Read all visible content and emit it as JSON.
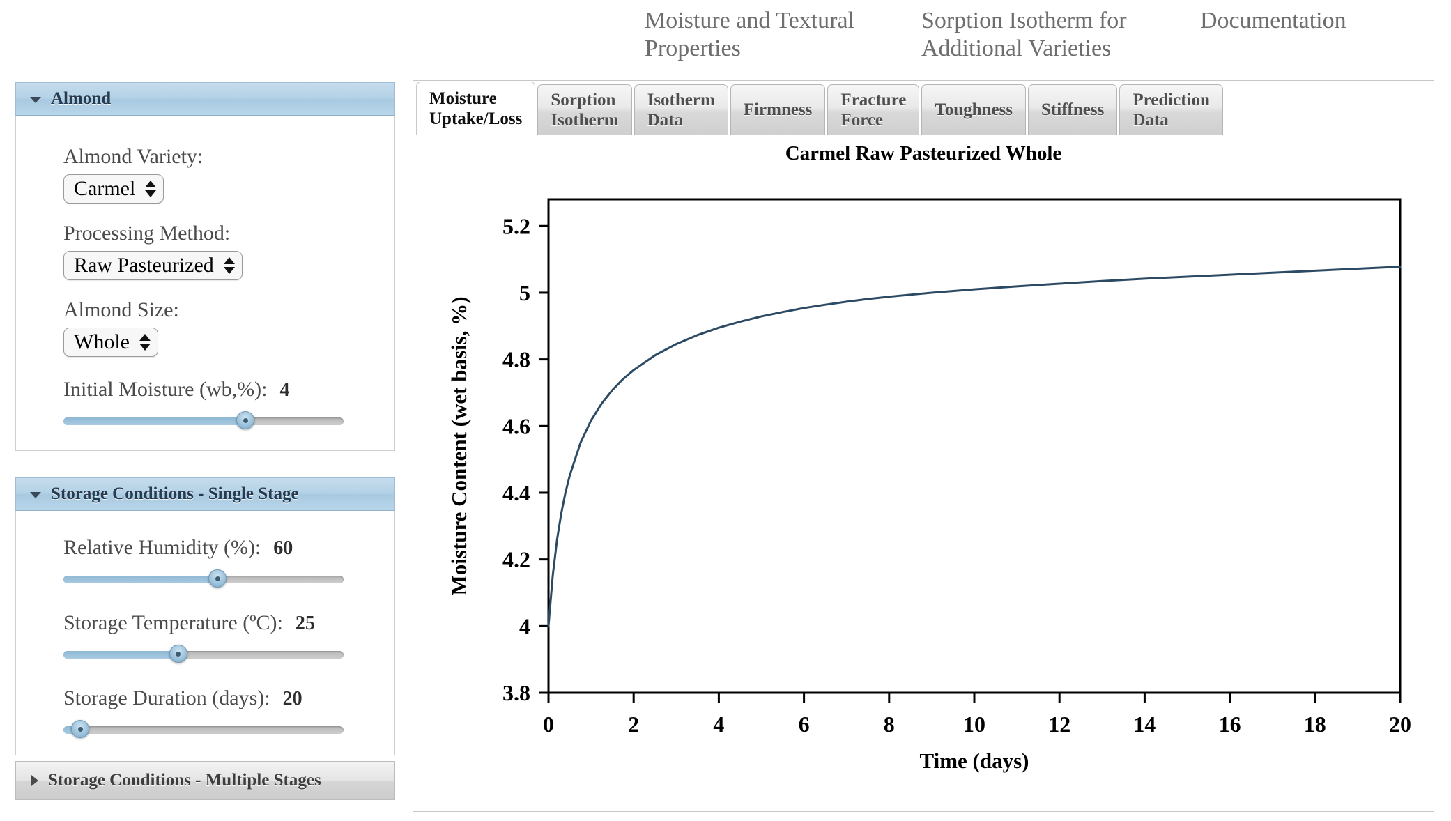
{
  "topnav": {
    "items": [
      {
        "label": "Moisture and Textural\nProperties"
      },
      {
        "label": "Sorption Isotherm for\nAdditional Varieties"
      },
      {
        "label": "Documentation"
      }
    ]
  },
  "sidebar": {
    "panels": [
      {
        "title": "Almond",
        "expanded": true,
        "controls": [
          {
            "type": "select",
            "label": "Almond Variety:",
            "value": "Carmel"
          },
          {
            "type": "select",
            "label": "Processing Method:",
            "value": "Raw Pasteurized"
          },
          {
            "type": "select",
            "label": "Almond Size:",
            "value": "Whole"
          },
          {
            "type": "slider",
            "label": "Initial Moisture (wb,%):",
            "value": "4",
            "min": 0,
            "max": 8,
            "fill_pct": 65
          }
        ]
      },
      {
        "title": "Storage Conditions - Single Stage",
        "expanded": true,
        "controls": [
          {
            "type": "slider",
            "label": "Relative Humidity (%):",
            "value": "60",
            "min": 0,
            "max": 100,
            "fill_pct": 55
          },
          {
            "type": "slider",
            "label": "Storage Temperature (ºC):",
            "value": "25",
            "min": 0,
            "max": 60,
            "fill_pct": 41
          },
          {
            "type": "slider",
            "label": "Storage Duration (days):",
            "value": "20",
            "min": 0,
            "max": 365,
            "fill_pct": 6
          }
        ]
      }
    ],
    "collapsed_panel": {
      "title": "Storage Conditions - Multiple Stages",
      "expanded": false
    }
  },
  "main": {
    "tabs": [
      {
        "label": "Moisture\nUptake/Loss",
        "active": true
      },
      {
        "label": "Sorption\nIsotherm",
        "active": false
      },
      {
        "label": "Isotherm\nData",
        "active": false
      },
      {
        "label": "Firmness",
        "active": false
      },
      {
        "label": "Fracture\nForce",
        "active": false
      },
      {
        "label": "Toughness",
        "active": false
      },
      {
        "label": "Stiffness",
        "active": false
      },
      {
        "label": "Prediction\nData",
        "active": false
      }
    ]
  },
  "chart_data": {
    "type": "line",
    "title": "Carmel Raw Pasteurized Whole",
    "xlabel": "Time (days)",
    "ylabel": "Moisture Content (wet basis, %)",
    "xlim": [
      0,
      20
    ],
    "ylim": [
      3.8,
      5.28
    ],
    "xticks": [
      0,
      2,
      4,
      6,
      8,
      10,
      12,
      14,
      16,
      18,
      20
    ],
    "xticklabels": [
      "0",
      "2",
      "4",
      "6",
      "8",
      "10",
      "12",
      "14",
      "16",
      "18",
      "20"
    ],
    "yticks": [
      3.8,
      4,
      4.2,
      4.4,
      4.6,
      4.8,
      5,
      5.2
    ],
    "yticklabels": [
      "3.8",
      "4",
      "4.2",
      "4.4",
      "4.6",
      "4.8",
      "5",
      "5.2"
    ],
    "grid": false,
    "legend": "none",
    "line_color": "#2c4a63",
    "line_width": 3,
    "series": [
      {
        "name": "Moisture Content",
        "x": [
          0,
          0.1,
          0.2,
          0.3,
          0.4,
          0.5,
          0.75,
          1,
          1.25,
          1.5,
          1.75,
          2,
          2.5,
          3,
          3.5,
          4,
          4.5,
          5,
          5.5,
          6,
          6.5,
          7,
          7.5,
          8,
          9,
          10,
          11,
          12,
          13,
          14,
          15,
          16,
          17,
          18,
          19,
          20
        ],
        "y": [
          4.0,
          4.151,
          4.258,
          4.338,
          4.401,
          4.452,
          4.549,
          4.617,
          4.668,
          4.708,
          4.741,
          4.768,
          4.812,
          4.846,
          4.873,
          4.895,
          4.913,
          4.929,
          4.942,
          4.954,
          4.964,
          4.973,
          4.981,
          4.988,
          5.0,
          5.01,
          5.019,
          5.027,
          5.035,
          5.042,
          5.048,
          5.054,
          5.06,
          5.066,
          5.072,
          5.078
        ]
      }
    ]
  }
}
